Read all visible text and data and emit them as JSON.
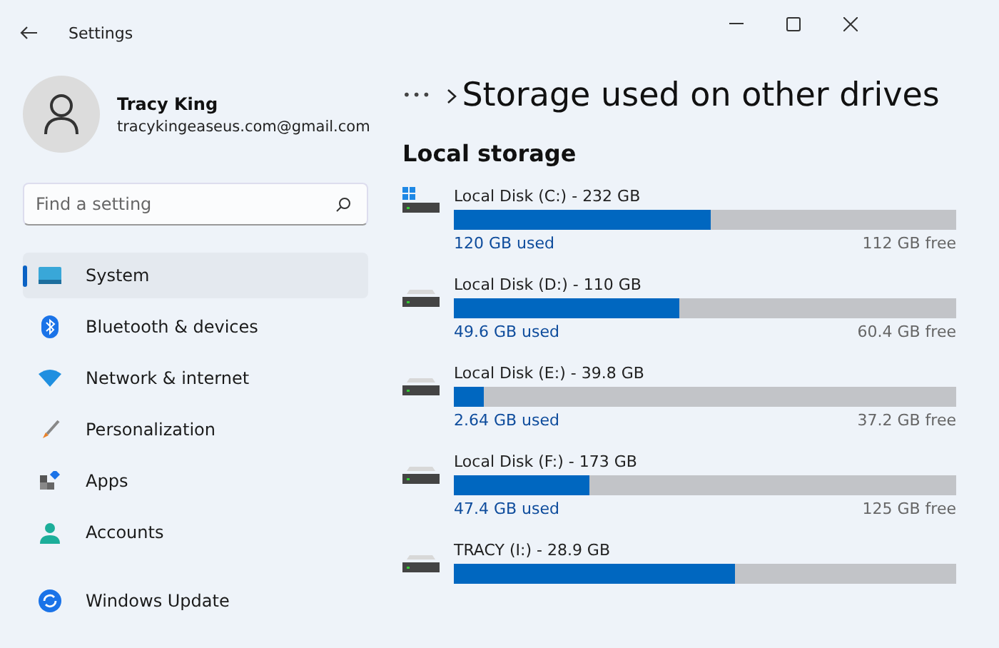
{
  "window": {
    "title": "Settings"
  },
  "user": {
    "name": "Tracy King",
    "email": "tracykingeaseus.com@gmail.com"
  },
  "search": {
    "placeholder": "Find a setting"
  },
  "nav": [
    {
      "label": "System",
      "kind": "system",
      "selected": true
    },
    {
      "label": "Bluetooth & devices",
      "kind": "bluetooth",
      "selected": false
    },
    {
      "label": "Network & internet",
      "kind": "network",
      "selected": false
    },
    {
      "label": "Personalization",
      "kind": "brush",
      "selected": false
    },
    {
      "label": "Apps",
      "kind": "apps",
      "selected": false
    },
    {
      "label": "Accounts",
      "kind": "accounts",
      "selected": false
    },
    {
      "label": "Windows Update",
      "kind": "update",
      "selected": false
    }
  ],
  "breadcrumb": {
    "more": "•••",
    "title": "Storage used on other drives"
  },
  "section": "Local storage",
  "drives": [
    {
      "name": "Local Disk (C:) - 232 GB",
      "kind": "system",
      "level": 0.51,
      "used": "120 GB used",
      "free": "112 GB free"
    },
    {
      "name": "Local Disk (D:) - 110 GB",
      "kind": "plain",
      "level": 0.45,
      "used": "49.6 GB used",
      "free": "60.4 GB free"
    },
    {
      "name": "Local Disk (E:) - 39.8 GB",
      "kind": "plain",
      "level": 0.06,
      "used": "2.64 GB used",
      "free": "37.2 GB free"
    },
    {
      "name": "Local Disk (F:) - 173 GB",
      "kind": "plain",
      "level": 0.27,
      "used": "47.4 GB used",
      "free": "125 GB free"
    },
    {
      "name": "TRACY (I:) - 28.9 GB",
      "kind": "plain",
      "level": 0.56
    }
  ]
}
